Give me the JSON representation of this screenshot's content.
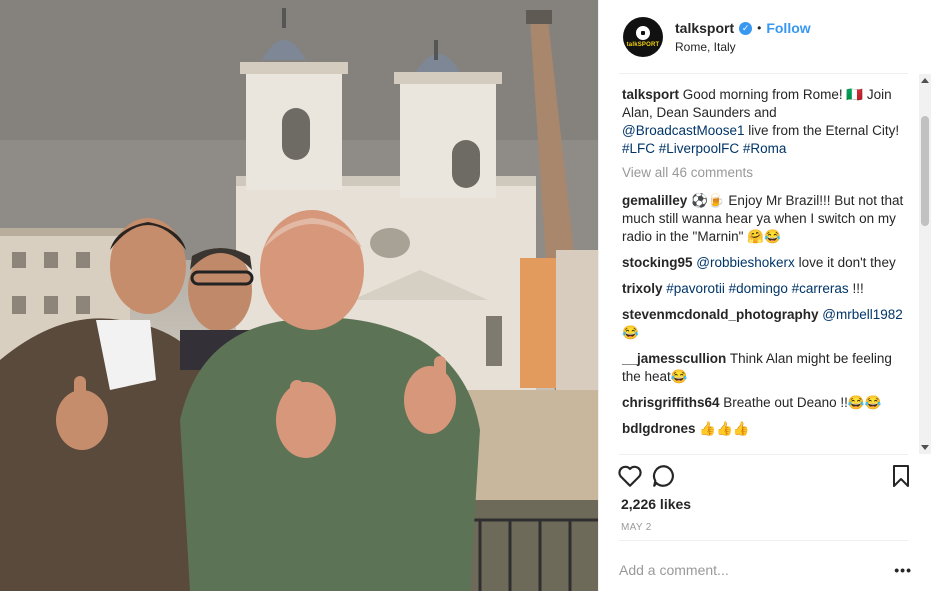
{
  "post": {
    "username": "talksport",
    "avatar_text": "talkSPORT",
    "dot": "•",
    "follow_label": "Follow",
    "location": "Rome, Italy",
    "caption": {
      "username": "talksport",
      "text_1": "Good morning from Rome! 🇮🇹 Join Alan, Dean Saunders and ",
      "mention": "@BroadcastMoose1",
      "text_2": " live from the Eternal City! ",
      "tag_1": "#LFC",
      "tag_2": "#LiverpoolFC",
      "tag_3": "#Roma"
    },
    "view_all": "View all 46 comments",
    "comments": [
      {
        "username": "gemalilley",
        "parts": [
          {
            "t": "⚽🍺 Enjoy Mr Brazil!!! But not that much still wanna hear ya when I switch on my radio in the \"Marnin\" 🤗😂",
            "link": false
          }
        ]
      },
      {
        "username": "stocking95",
        "parts": [
          {
            "t": "@robbieshokerx",
            "link": true
          },
          {
            "t": " love it don't they",
            "link": false
          }
        ]
      },
      {
        "username": "trixoly",
        "parts": [
          {
            "t": "#pavorotii",
            "link": true
          },
          {
            "t": " ",
            "link": false
          },
          {
            "t": "#domingo",
            "link": true
          },
          {
            "t": " ",
            "link": false
          },
          {
            "t": "#carreras",
            "link": true
          },
          {
            "t": " !!!",
            "link": false
          }
        ]
      },
      {
        "username": "stevenmcdonald_photography",
        "parts": [
          {
            "t": "@mrbell1982",
            "link": true
          },
          {
            "t": " 😂",
            "link": false
          }
        ]
      },
      {
        "username": "__jamesscullion",
        "parts": [
          {
            "t": "Think Alan might be feeling the heat😂",
            "link": false
          }
        ]
      },
      {
        "username": "chrisgriffiths64",
        "parts": [
          {
            "t": "Breathe out Deano !!😂😂",
            "link": false
          }
        ]
      },
      {
        "username": "bdlgdrones",
        "parts": [
          {
            "t": "👍👍👍",
            "link": false
          }
        ]
      }
    ],
    "likes": "2,226 likes",
    "date": "MAY 2",
    "comment_placeholder": "Add a comment...",
    "more_label": "•••"
  },
  "icons": {
    "like": "heart-icon",
    "comment": "comment-bubble-icon",
    "save": "bookmark-icon",
    "verified": "verified-badge-icon",
    "more": "ellipsis-icon"
  },
  "colors": {
    "link": "#003569",
    "follow": "#3897f0",
    "muted": "#999999",
    "text": "#262626"
  }
}
